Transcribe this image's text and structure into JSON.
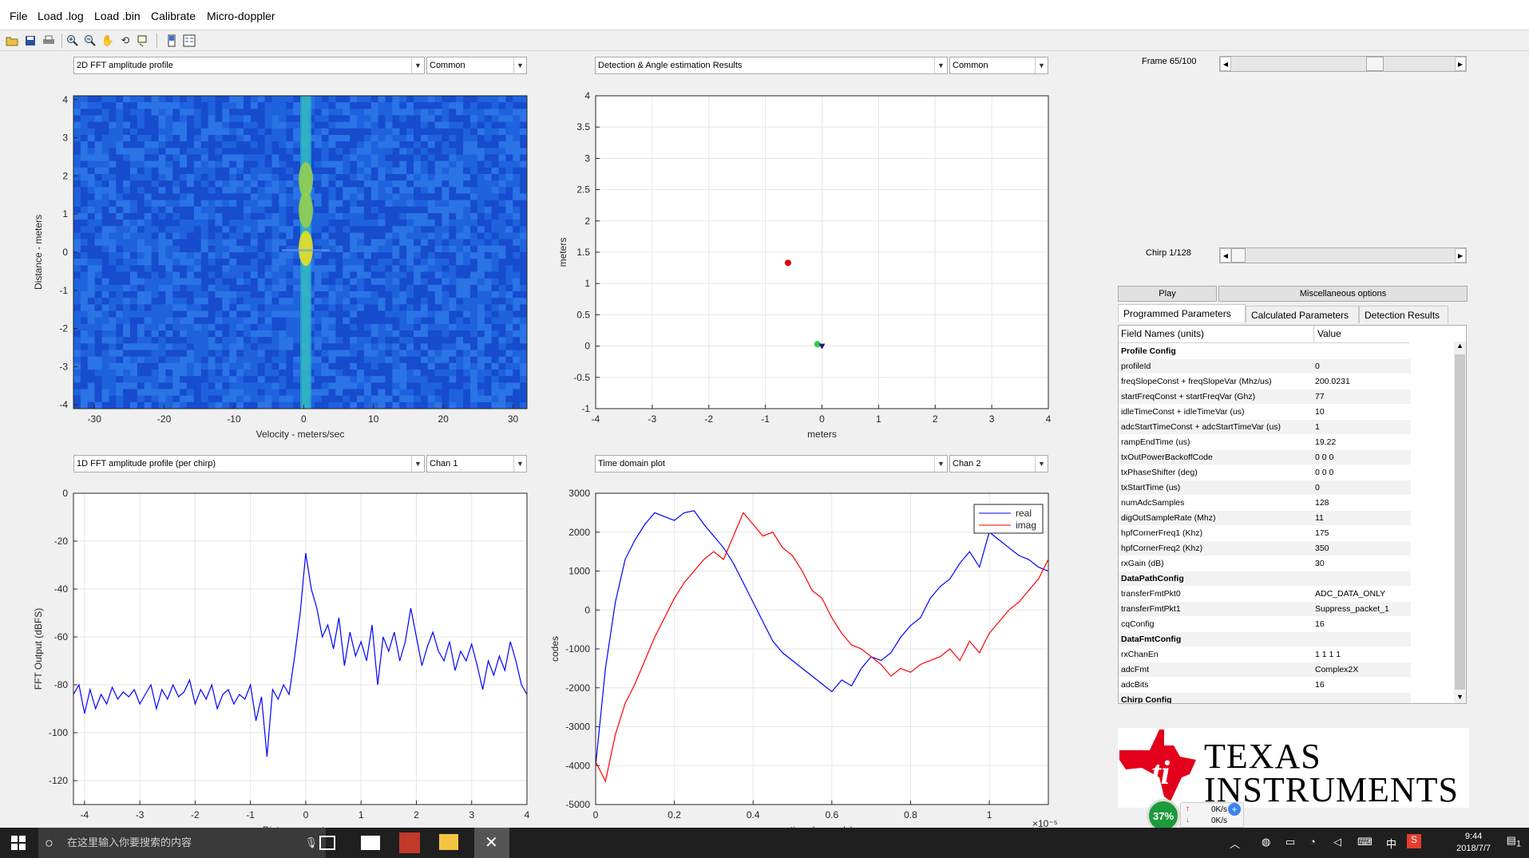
{
  "menu": [
    "File",
    "Load .log",
    "Load .bin",
    "Calibrate",
    "Micro-doppler"
  ],
  "toolbar_icons": [
    "open-icon",
    "save-icon",
    "print-icon",
    "zoom-in-icon",
    "zoom-out-icon",
    "pan-icon",
    "rotate-icon",
    "datacursor-icon",
    "colorbar-icon",
    "legend-icon"
  ],
  "plot1": {
    "select": "2D FFT amplitude profile",
    "select2": "Common",
    "xlabel": "Velocity - meters/sec",
    "ylabel": "Distance - meters",
    "xticks": [
      "-30",
      "-20",
      "-10",
      "0",
      "10",
      "20",
      "30"
    ],
    "yticks": [
      "4",
      "3",
      "2",
      "1",
      "0",
      "-1",
      "-2",
      "-3",
      "-4"
    ]
  },
  "plot2": {
    "select": "Detection & Angle estimation Results",
    "select2": "Common",
    "xlabel": "meters",
    "ylabel": "meters",
    "xticks": [
      "-4",
      "-3",
      "-2",
      "-1",
      "0",
      "1",
      "2",
      "3",
      "4"
    ],
    "yticks": [
      "4",
      "3.5",
      "3",
      "2.5",
      "2",
      "1.5",
      "1",
      "0.5",
      "0",
      "-0.5",
      "-1"
    ]
  },
  "plot3": {
    "select": "1D FFT amplitude profile (per chirp)",
    "select2": "Chan 1",
    "xlabel": "Distance - meters",
    "ylabel": "FFT Output (dBFS)",
    "xticks": [
      "-4",
      "-3",
      "-2",
      "-1",
      "0",
      "1",
      "2",
      "3",
      "4"
    ],
    "yticks": [
      "0",
      "-20",
      "-40",
      "-60",
      "-80",
      "-100",
      "-120"
    ]
  },
  "plot4": {
    "select": "Time domain plot",
    "select2": "Chan 2",
    "xlabel": "time (seconds)",
    "ylabel": "codes",
    "xexp": "×10⁻⁵",
    "xticks": [
      "0",
      "0.2",
      "0.4",
      "0.6",
      "0.8",
      "1"
    ],
    "yticks": [
      "3000",
      "2000",
      "1000",
      "0",
      "-1000",
      "-2000",
      "-3000",
      "-4000",
      "-5000"
    ],
    "legend": [
      "real",
      "imag"
    ]
  },
  "chart_data": [
    {
      "type": "heatmap",
      "title": "",
      "xlabel": "Velocity - meters/sec",
      "ylabel": "Distance - meters",
      "xlim": [
        -33,
        32
      ],
      "ylim": [
        -4.1,
        4.1
      ],
      "note_series": "bright column near velocity 0, peak near distance 0",
      "column_peak_velocity": 0.3,
      "peaks": [
        {
          "x": 0.3,
          "y": 0.1
        },
        {
          "x": 0.3,
          "y": 1.9
        },
        {
          "x": 0.3,
          "y": 1.1
        }
      ]
    },
    {
      "type": "scatter",
      "xlabel": "meters",
      "ylabel": "meters",
      "xlim": [
        -4,
        4
      ],
      "ylim": [
        -1,
        4
      ],
      "series": [
        {
          "color": "#e00000",
          "x": [
            -0.6
          ],
          "y": [
            1.33
          ]
        },
        {
          "color": "#2ecc40",
          "x": [
            -0.08
          ],
          "y": [
            0.03
          ]
        },
        {
          "color": "#1a1a8c",
          "x": [
            0.0
          ],
          "y": [
            0.0
          ]
        }
      ]
    },
    {
      "type": "line",
      "xlabel": "Distance - meters",
      "ylabel": "FFT Output (dBFS)",
      "xlim": [
        -4.2,
        4.0
      ],
      "ylim": [
        -130,
        0
      ],
      "series": [
        {
          "color": "#0000ff",
          "x": [
            -4.2,
            -4.1,
            -4.0,
            -3.9,
            -3.8,
            -3.7,
            -3.6,
            -3.5,
            -3.4,
            -3.3,
            -3.2,
            -3.1,
            -3.0,
            -2.9,
            -2.8,
            -2.7,
            -2.6,
            -2.5,
            -2.4,
            -2.3,
            -2.2,
            -2.1,
            -2.0,
            -1.9,
            -1.8,
            -1.7,
            -1.6,
            -1.5,
            -1.4,
            -1.3,
            -1.2,
            -1.1,
            -1.0,
            -0.9,
            -0.8,
            -0.7,
            -0.6,
            -0.5,
            -0.4,
            -0.3,
            -0.2,
            -0.1,
            0.0,
            0.1,
            0.2,
            0.3,
            0.4,
            0.5,
            0.6,
            0.7,
            0.8,
            0.9,
            1.0,
            1.1,
            1.2,
            1.3,
            1.4,
            1.5,
            1.6,
            1.7,
            1.8,
            1.9,
            2.0,
            2.1,
            2.2,
            2.3,
            2.4,
            2.5,
            2.6,
            2.7,
            2.8,
            2.9,
            3.0,
            3.1,
            3.2,
            3.3,
            3.4,
            3.5,
            3.6,
            3.7,
            3.8,
            3.9,
            4.0
          ],
          "y": [
            -84,
            -80,
            -92,
            -82,
            -90,
            -84,
            -88,
            -81,
            -86,
            -83,
            -85,
            -82,
            -88,
            -84,
            -80,
            -90,
            -82,
            -86,
            -80,
            -85,
            -83,
            -78,
            -88,
            -82,
            -86,
            -80,
            -90,
            -84,
            -82,
            -88,
            -84,
            -86,
            -80,
            -95,
            -85,
            -110,
            -82,
            -86,
            -80,
            -84,
            -68,
            -50,
            -25,
            -40,
            -48,
            -60,
            -55,
            -65,
            -52,
            -72,
            -58,
            -68,
            -62,
            -70,
            -55,
            -80,
            -60,
            -66,
            -58,
            -70,
            -62,
            -48,
            -60,
            -72,
            -64,
            -58,
            -66,
            -70,
            -62,
            -74,
            -66,
            -70,
            -63,
            -72,
            -82,
            -70,
            -76,
            -68,
            -74,
            -62,
            -70,
            -80,
            -84
          ]
        }
      ]
    },
    {
      "type": "line",
      "xlabel": "time (seconds)",
      "ylabel": "codes",
      "xlim": [
        0,
        1.15
      ],
      "ylim": [
        -5000,
        3000
      ],
      "series": [
        {
          "name": "real",
          "color": "#0000ff",
          "x": [
            0,
            0.025,
            0.05,
            0.075,
            0.1,
            0.125,
            0.15,
            0.175,
            0.2,
            0.225,
            0.25,
            0.275,
            0.3,
            0.325,
            0.35,
            0.375,
            0.4,
            0.425,
            0.45,
            0.475,
            0.5,
            0.525,
            0.55,
            0.575,
            0.6,
            0.625,
            0.65,
            0.675,
            0.7,
            0.725,
            0.75,
            0.775,
            0.8,
            0.825,
            0.85,
            0.875,
            0.9,
            0.925,
            0.95,
            0.975,
            1.0,
            1.025,
            1.05,
            1.075,
            1.1,
            1.125,
            1.15
          ],
          "y": [
            -4000,
            -1500,
            200,
            1300,
            1800,
            2200,
            2500,
            2400,
            2300,
            2500,
            2550,
            2200,
            1900,
            1600,
            1200,
            700,
            200,
            -300,
            -800,
            -1100,
            -1300,
            -1500,
            -1700,
            -1900,
            -2100,
            -1800,
            -1950,
            -1500,
            -1200,
            -1300,
            -1100,
            -700,
            -400,
            -200,
            300,
            600,
            800,
            1200,
            1500,
            1100,
            2000,
            1800,
            1600,
            1400,
            1300,
            1100,
            1000
          ]
        },
        {
          "name": "imag",
          "color": "#ff0000",
          "x": [
            0,
            0.025,
            0.05,
            0.075,
            0.1,
            0.125,
            0.15,
            0.175,
            0.2,
            0.225,
            0.25,
            0.275,
            0.3,
            0.325,
            0.35,
            0.375,
            0.4,
            0.425,
            0.45,
            0.475,
            0.5,
            0.525,
            0.55,
            0.575,
            0.6,
            0.625,
            0.65,
            0.675,
            0.7,
            0.725,
            0.75,
            0.775,
            0.8,
            0.825,
            0.85,
            0.875,
            0.9,
            0.925,
            0.95,
            0.975,
            1.0,
            1.025,
            1.05,
            1.075,
            1.1,
            1.125,
            1.15
          ],
          "y": [
            -3900,
            -4400,
            -3200,
            -2400,
            -1900,
            -1300,
            -700,
            -200,
            300,
            700,
            1000,
            1300,
            1500,
            1300,
            1900,
            2500,
            2200,
            1900,
            2000,
            1600,
            1400,
            1000,
            500,
            300,
            -200,
            -600,
            -900,
            -1000,
            -1200,
            -1400,
            -1700,
            -1500,
            -1600,
            -1400,
            -1300,
            -1200,
            -1000,
            -1300,
            -800,
            -1100,
            -600,
            -300,
            0,
            200,
            500,
            800,
            1300
          ]
        }
      ]
    }
  ],
  "right_panel": {
    "frame_label": "Frame 65/100",
    "frame_value": 0.65,
    "chirp_label": "Chirp 1/128",
    "chirp_value": 0.0,
    "play": "Play",
    "misc": "Miscellaneous options",
    "tabs": [
      "Programmed Parameters",
      "Calculated Parameters",
      "Detection Results"
    ],
    "table_headers": [
      "Field Names     (units)",
      "Value"
    ],
    "rows": [
      {
        "name": "Profile Config",
        "value": "",
        "header": true
      },
      {
        "name": "profileId",
        "value": "0"
      },
      {
        "name": "freqSlopeConst + freqSlopeVar (Mhz/us)",
        "value": "200.0231"
      },
      {
        "name": "startFreqConst + startFreqVar (Ghz)",
        "value": "77"
      },
      {
        "name": "idleTimeConst + idleTimeVar (us)",
        "value": "10"
      },
      {
        "name": "adcStartTimeConst + adcStartTimeVar (us)",
        "value": "1"
      },
      {
        "name": "rampEndTime (us)",
        "value": "19.22"
      },
      {
        "name": "txOutPowerBackoffCode",
        "value": "0 0 0"
      },
      {
        "name": "txPhaseShifter (deg)",
        "value": "0 0 0"
      },
      {
        "name": "txStartTime (us)",
        "value": "0"
      },
      {
        "name": "numAdcSamples",
        "value": "128"
      },
      {
        "name": "digOutSampleRate (Mhz)",
        "value": "11"
      },
      {
        "name": "hpfCornerFreq1 (Khz)",
        "value": "175"
      },
      {
        "name": "hpfCornerFreq2 (Khz)",
        "value": "350"
      },
      {
        "name": "rxGain (dB)",
        "value": "30"
      },
      {
        "name": "DataPathConfig",
        "value": "",
        "header": true
      },
      {
        "name": "transferFmtPkt0",
        "value": "ADC_DATA_ONLY"
      },
      {
        "name": "transferFmtPkt1",
        "value": "Suppress_packet_1"
      },
      {
        "name": "cqConfig",
        "value": "16"
      },
      {
        "name": "DataFmtConfig",
        "value": "",
        "header": true
      },
      {
        "name": "rxChanEn",
        "value": "1 1 1 1"
      },
      {
        "name": "adcFmt",
        "value": "Complex2X"
      },
      {
        "name": "adcBits",
        "value": "16"
      },
      {
        "name": "Chirp Config",
        "value": "",
        "header": true
      }
    ],
    "logo": [
      "TEXAS",
      "INSTRUMENTS"
    ]
  },
  "netmon": {
    "percent": "37%",
    "up": "0K/s",
    "down": "0K/s"
  },
  "taskbar": {
    "search_placeholder": "在这里输入你要搜索的内容",
    "time": "9:44",
    "date": "2018/7/7",
    "ime": "中",
    "notifications": "1"
  }
}
